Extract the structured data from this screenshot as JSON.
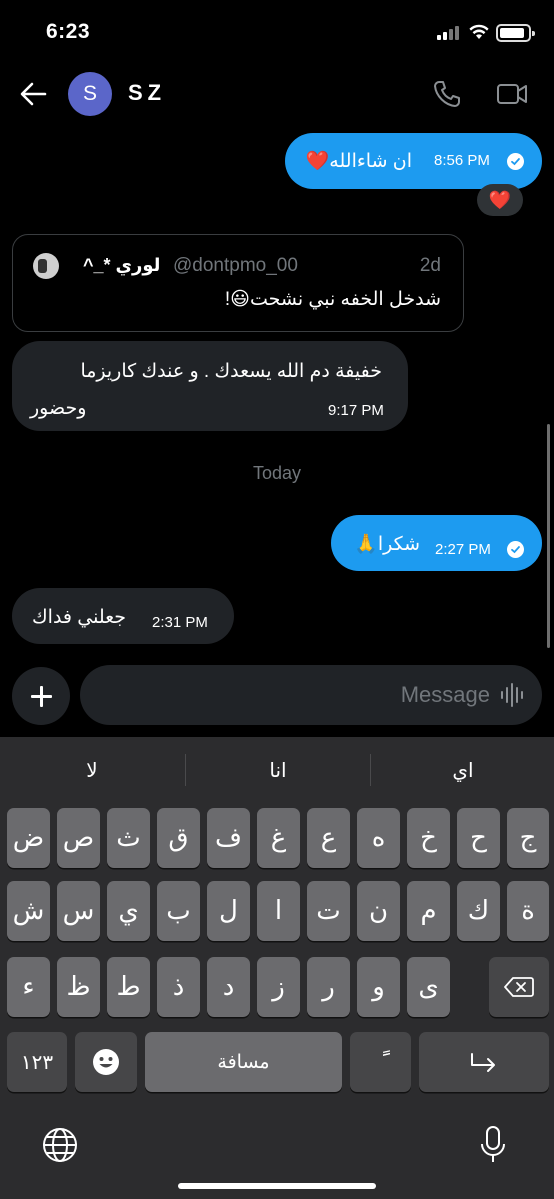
{
  "status": {
    "time": "6:23"
  },
  "header": {
    "avatar_letter": "S",
    "contact_name": "SZ"
  },
  "messages": [
    {
      "side": "out",
      "text": "ان شاءالله❤️",
      "time": "8:56 PM",
      "reaction": "❤️"
    },
    {
      "side": "quote",
      "name": "لوري *_^",
      "handle": "@dontpmo_00",
      "age": "2d",
      "text": "شدخل الخفه نبي نشحت😃!"
    },
    {
      "side": "in",
      "text_line1": "خفيفة دم الله يسعدك . و عندك كاريزما",
      "text_line2": "وحضور",
      "time": "9:17 PM"
    },
    {
      "side": "separator",
      "text": "Today"
    },
    {
      "side": "out",
      "text": "شكرا🙏",
      "time": "2:27 PM"
    },
    {
      "side": "in",
      "text": "جعلني فداك",
      "time": "2:31 PM"
    }
  ],
  "composer": {
    "placeholder": "Message"
  },
  "keyboard": {
    "suggestions": [
      "لا",
      "انا",
      "اي"
    ],
    "row1": [
      "ض",
      "ص",
      "ث",
      "ق",
      "ف",
      "غ",
      "ع",
      "ه",
      "خ",
      "ح",
      "ج"
    ],
    "row2": [
      "ش",
      "س",
      "ي",
      "ب",
      "ل",
      "ا",
      "ت",
      "ن",
      "م",
      "ك",
      "ة"
    ],
    "row3": [
      "ء",
      "ظ",
      "ط",
      "ذ",
      "د",
      "ز",
      "ر",
      "و",
      "ى"
    ],
    "numbers_label": "١٢٣",
    "space_label": "مسافة",
    "diacritic_label": "ًَ"
  },
  "colors": {
    "accent": "#1d9bf0",
    "incoming": "#202327",
    "background": "#000000",
    "key": "#6b6b6e"
  }
}
